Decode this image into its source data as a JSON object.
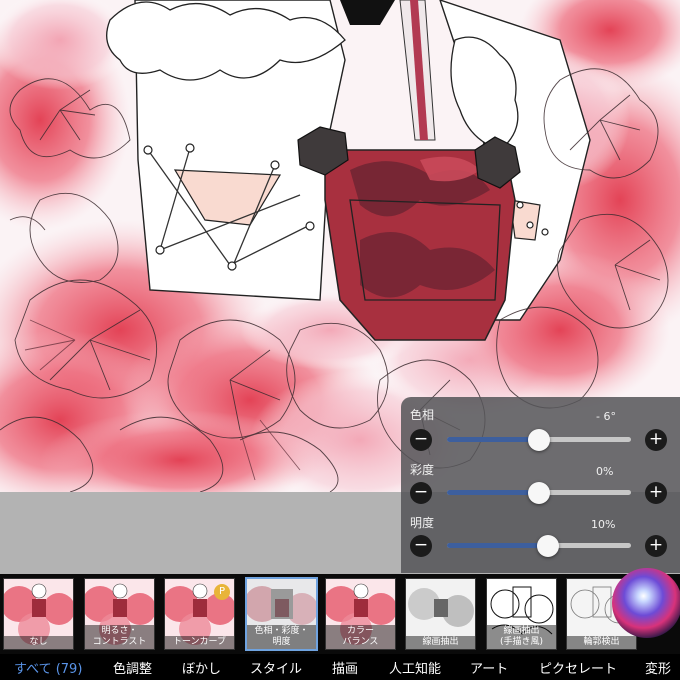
{
  "adjustments": {
    "hue": {
      "label": "色相",
      "value_text": "- 6°",
      "position": 0.5
    },
    "saturation": {
      "label": "彩度",
      "value_text": "0%",
      "position": 0.5
    },
    "brightness": {
      "label": "明度",
      "value_text": "10%",
      "position": 0.55
    },
    "minus_symbol": "−",
    "plus_symbol": "+"
  },
  "filters": [
    {
      "lines": [
        "なし"
      ]
    },
    {
      "lines": [
        "明るさ・",
        "コントラスト"
      ]
    },
    {
      "lines": [
        "トーンカーブ"
      ],
      "badge": "P"
    },
    {
      "lines": [
        "色相・彩度・",
        "明度"
      ],
      "selected": true
    },
    {
      "lines": [
        "カラー",
        "バランス"
      ]
    },
    {
      "lines": [
        "線画抽出"
      ]
    },
    {
      "lines": [
        "線画抽出",
        "(手描き風)"
      ]
    },
    {
      "lines": [
        "輪郭検出"
      ]
    }
  ],
  "categories": [
    {
      "label": "すべて (79)",
      "active": true
    },
    {
      "label": "色調整"
    },
    {
      "label": "ぼかし"
    },
    {
      "label": "スタイル"
    },
    {
      "label": "描画"
    },
    {
      "label": "人工知能"
    },
    {
      "label": "アート"
    },
    {
      "label": "ピクセレート"
    },
    {
      "label": "変形"
    }
  ],
  "colors": {
    "accent": "#5a94e8",
    "selected_border": "#6fa3e0",
    "slider_fill": "#3d5f9e",
    "badge": "#e8b43a",
    "panel_bg": "#555558"
  },
  "icons": [
    "siri-icon"
  ]
}
